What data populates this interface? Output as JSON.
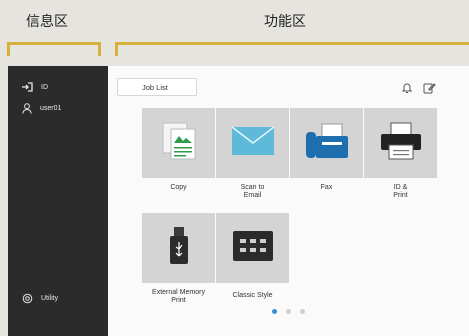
{
  "labels": {
    "info_zone": "信息区",
    "function_zone": "功能区"
  },
  "sidebar": {
    "id_label": "ID",
    "user": "user01",
    "utility": "Utility"
  },
  "toolbar": {
    "job_list": "Job List"
  },
  "tiles": [
    {
      "label": "Copy",
      "icon": "copy-icon"
    },
    {
      "label": "Scan to\nEmail",
      "icon": "envelope-icon"
    },
    {
      "label": "Fax",
      "icon": "fax-icon"
    },
    {
      "label": "ID &\nPrint",
      "icon": "printer-icon"
    },
    {
      "label": "External Memory\nPrint",
      "icon": "usb-icon"
    },
    {
      "label": "Classic Style",
      "icon": "classic-style-icon"
    }
  ],
  "pager": {
    "pages": 3,
    "current": 1
  },
  "colors": {
    "accent": "#d8ae3e",
    "active_dot": "#3a8fd0",
    "sidebar_bg": "#2b2b2b"
  }
}
